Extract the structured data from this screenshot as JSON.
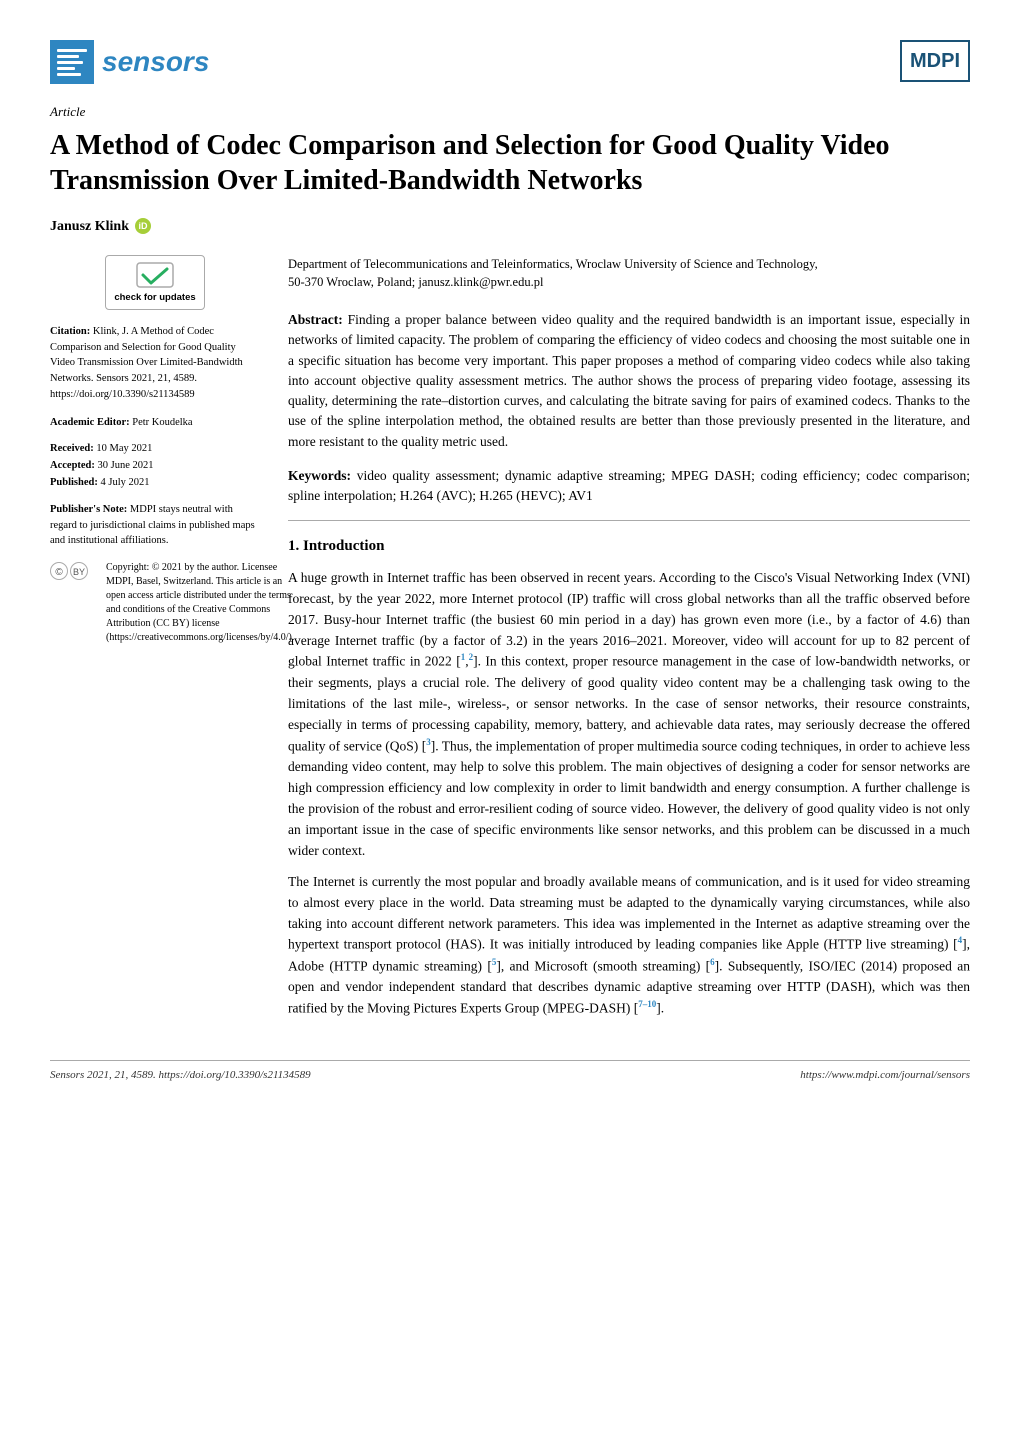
{
  "header": {
    "sensors_text": "sensors",
    "mdpi_text": "MDPI"
  },
  "article": {
    "label": "Article",
    "title": "A Method of Codec Comparison and Selection for Good Quality Video Transmission Over Limited-Bandwidth Networks",
    "author": "Janusz Klink",
    "affiliation_line1": "Department of Telecommunications and Teleinformatics, Wroclaw University of Science and Technology,",
    "affiliation_line2": "50-370 Wroclaw, Poland; janusz.klink@pwr.edu.pl"
  },
  "abstract": {
    "label": "Abstract:",
    "text": "Finding a proper balance between video quality and the required bandwidth is an important issue, especially in networks of limited capacity. The problem of comparing the efficiency of video codecs and choosing the most suitable one in a specific situation has become very important. This paper proposes a method of comparing video codecs while also taking into account objective quality assessment metrics. The author shows the process of preparing video footage, assessing its quality, determining the rate–distortion curves, and calculating the bitrate saving for pairs of examined codecs. Thanks to the use of the spline interpolation method, the obtained results are better than those previously presented in the literature, and more resistant to the quality metric used."
  },
  "keywords": {
    "label": "Keywords:",
    "text": "video quality assessment; dynamic adaptive streaming; MPEG DASH; coding efficiency; codec comparison; spline interpolation; H.264 (AVC); H.265 (HEVC); AV1"
  },
  "check_updates": {
    "text": "check for updates"
  },
  "citation": {
    "label": "Citation:",
    "text": "Klink, J. A Method of Codec Comparison and Selection for Good Quality Video Transmission Over Limited-Bandwidth Networks. Sensors 2021, 21, 4589. https://doi.org/10.3390/s21134589"
  },
  "academic_editor": {
    "label": "Academic Editor:",
    "name": "Petr Koudelka"
  },
  "dates": {
    "received_label": "Received:",
    "received": "10 May 2021",
    "accepted_label": "Accepted:",
    "accepted": "30 June 2021",
    "published_label": "Published:",
    "published": "4 July 2021"
  },
  "publisher_note": {
    "label": "Publisher's Note:",
    "text": "MDPI stays neutral with regard to jurisdictional claims in published maps and institutional affiliations."
  },
  "copyright": {
    "text": "Copyright: © 2021 by the author. Licensee MDPI, Basel, Switzerland. This article is an open access article distributed under the terms and conditions of the Creative Commons Attribution (CC BY) license (https://creativecommons.org/licenses/by/4.0/)."
  },
  "sections": {
    "intro": {
      "heading": "1. Introduction",
      "para1": "A huge growth in Internet traffic has been observed in recent years. According to the Cisco's Visual Networking Index (VNI) forecast, by the year 2022, more Internet protocol (IP) traffic will cross global networks than all the traffic observed before 2017. Busy-hour Internet traffic (the busiest 60 min period in a day) has grown even more (i.e., by a factor of 4.6) than average Internet traffic (by a factor of 3.2) in the years 2016–2021. Moreover, video will account for up to 82 percent of global Internet traffic in 2022 [1,2]. In this context, proper resource management in the case of low-bandwidth networks, or their segments, plays a crucial role. The delivery of good quality video content may be a challenging task owing to the limitations of the last mile-, wireless-, or sensor networks. In the case of sensor networks, their resource constraints, especially in terms of processing capability, memory, battery, and achievable data rates, may seriously decrease the offered quality of service (QoS) [3]. Thus, the implementation of proper multimedia source coding techniques, in order to achieve less demanding video content, may help to solve this problem. The main objectives of designing a coder for sensor networks are high compression efficiency and low complexity in order to limit bandwidth and energy consumption. A further challenge is the provision of the robust and error-resilient coding of source video. However, the delivery of good quality video is not only an important issue in the case of specific environments like sensor networks, and this problem can be discussed in a much wider context.",
      "para2": "The Internet is currently the most popular and broadly available means of communication, and is it used for video streaming to almost every place in the world. Data streaming must be adapted to the dynamically varying circumstances, while also taking into account different network parameters. This idea was implemented in the Internet as adaptive streaming over the hypertext transport protocol (HAS). It was initially introduced by leading companies like Apple (HTTP live streaming) [4], Adobe (HTTP dynamic streaming) [5], and Microsoft (smooth streaming) [6]. Subsequently, ISO/IEC (2014) proposed an open and vendor independent standard that describes dynamic adaptive streaming over HTTP (DASH), which was then ratified by the Moving Pictures Experts Group (MPEG-DASH) [7–10]."
    }
  },
  "footer": {
    "left": "Sensors 2021, 21, 4589. https://doi.org/10.3390/s21134589",
    "right": "https://www.mdpi.com/journal/sensors"
  }
}
